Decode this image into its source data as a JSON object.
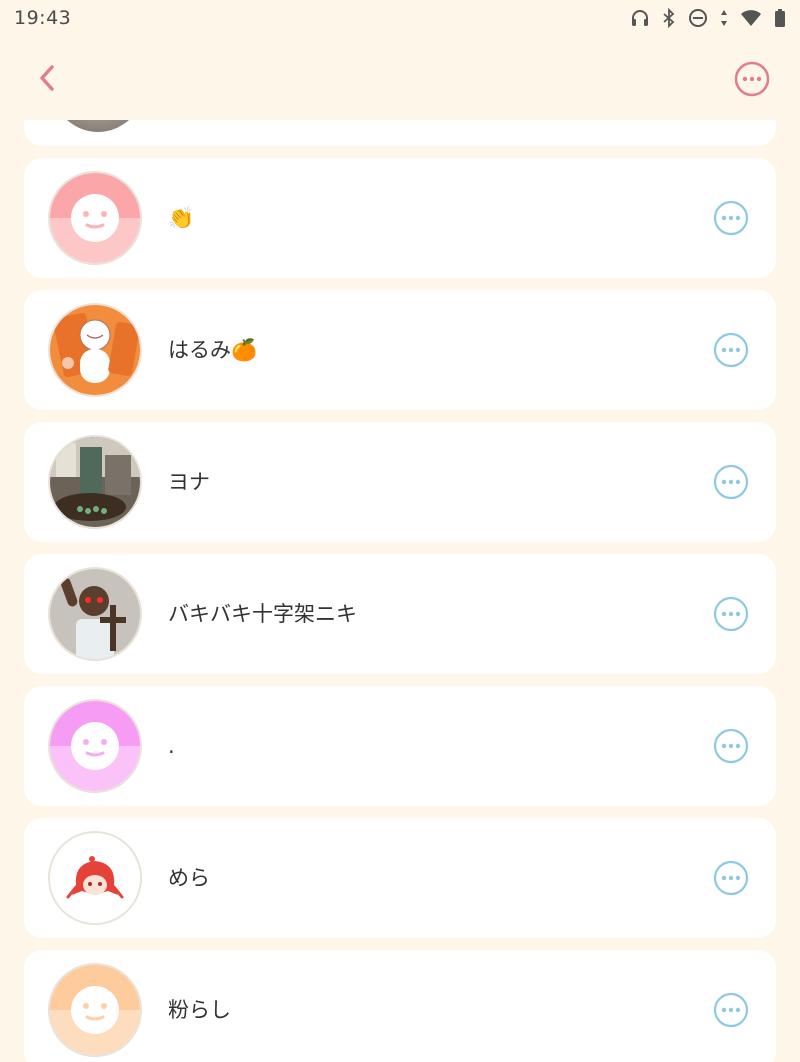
{
  "status_bar": {
    "time": "19:43",
    "icons": [
      "headphones-icon",
      "bluetooth-icon",
      "do-not-disturb-icon",
      "data-arrows-icon",
      "wifi-icon",
      "battery-icon"
    ]
  },
  "app_bar": {
    "back_icon": "chevron-left-icon",
    "menu_icon": "more-horizontal-circle-icon",
    "accent_color": "#E27D8B"
  },
  "list": {
    "more_icon_color": "#8EC9E0",
    "items": [
      {
        "name": "👏",
        "avatar": "default-face-pink"
      },
      {
        "name": "はるみ🍊",
        "avatar": "drawing-orange"
      },
      {
        "name": "ヨナ",
        "avatar": "photo-room"
      },
      {
        "name": "バキバキ十字架ニキ",
        "avatar": "photo-person-cross"
      },
      {
        "name": ".",
        "avatar": "default-face-magenta"
      },
      {
        "name": "めら",
        "avatar": "anime-character-red-hair"
      },
      {
        "name": "粉らし",
        "avatar": "default-face-peach"
      }
    ]
  }
}
